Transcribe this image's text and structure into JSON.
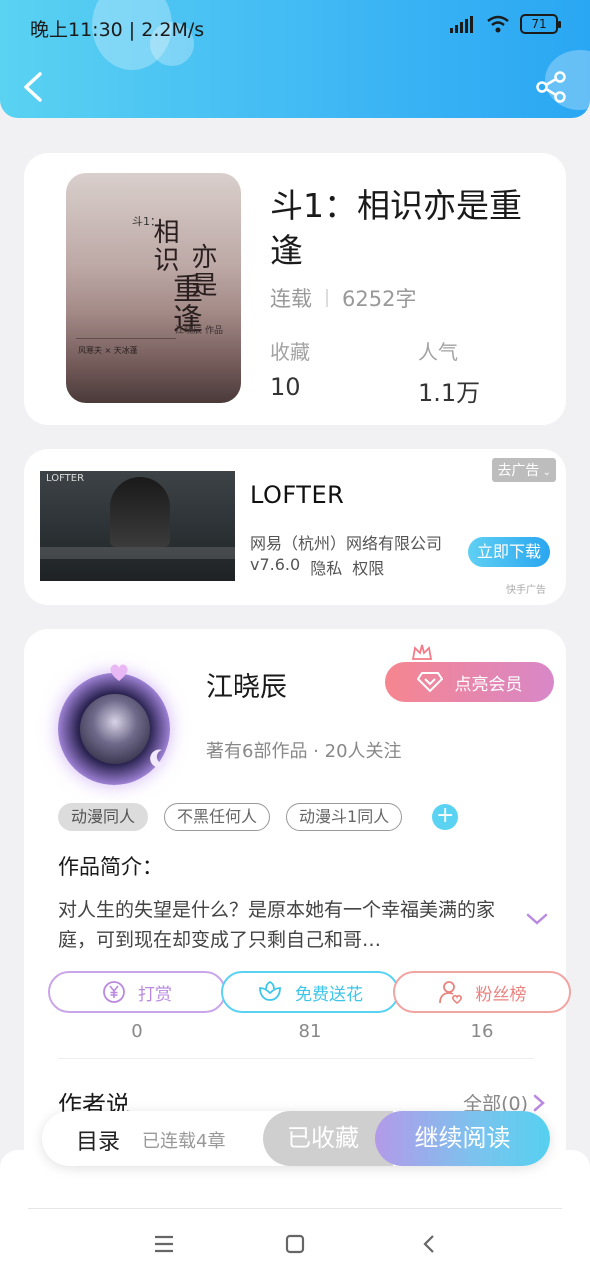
{
  "status_bar": {
    "time": "晚上11:30 | 2.2M/s",
    "battery": "71"
  },
  "book": {
    "cover": {
      "title_small": "斗1：",
      "title_line1": "相识",
      "title_line2": "亦是",
      "title_line3": "重逢",
      "author": "江晓辰 作品",
      "caption": "风寒夫 × 天冰蓬"
    },
    "title": "斗1：相识亦是重逢",
    "status": "连载",
    "word_count": "6252字",
    "favorites_label": "收藏",
    "favorites_value": "10",
    "popularity_label": "人气",
    "popularity_value": "1.1万"
  },
  "ad": {
    "image_logo": "LOFTER",
    "title": "LOFTER",
    "company": "网易（杭州）网络有限公司",
    "version": "v7.6.0",
    "privacy": "隐私",
    "permissions": "权限",
    "remove_label": "去广告",
    "download_label": "立即下载",
    "source": "快手广告"
  },
  "author": {
    "name": "江晓辰",
    "vip_label": "点亮会员",
    "stats": "著有6部作品 · 20人关注",
    "tags": [
      "动漫同人",
      "不黑任何人",
      "动漫斗1同人"
    ],
    "intro_label": "作品简介：",
    "intro_text": "对人生的失望是什么？是原本她有一个幸福美满的家庭，可到现在却变成了只剩自己和哥…",
    "actions": [
      {
        "label": "打赏",
        "count": "0"
      },
      {
        "label": "免费送花",
        "count": "81"
      },
      {
        "label": "粉丝榜",
        "count": "16"
      }
    ],
    "author_say_label": "作者说",
    "author_say_all": "全部(0)"
  },
  "bottom_bar": {
    "catalog": "目录",
    "chapters": "已连载4章",
    "collected": "已收藏",
    "continue": "继续阅读"
  },
  "colors": {
    "header_start": "#5ad2f2",
    "header_end": "#2aa7f3",
    "accent_cyan": "#3ec6ea",
    "reward_purple": "#b98ae0",
    "fans_red": "#e9837f"
  }
}
